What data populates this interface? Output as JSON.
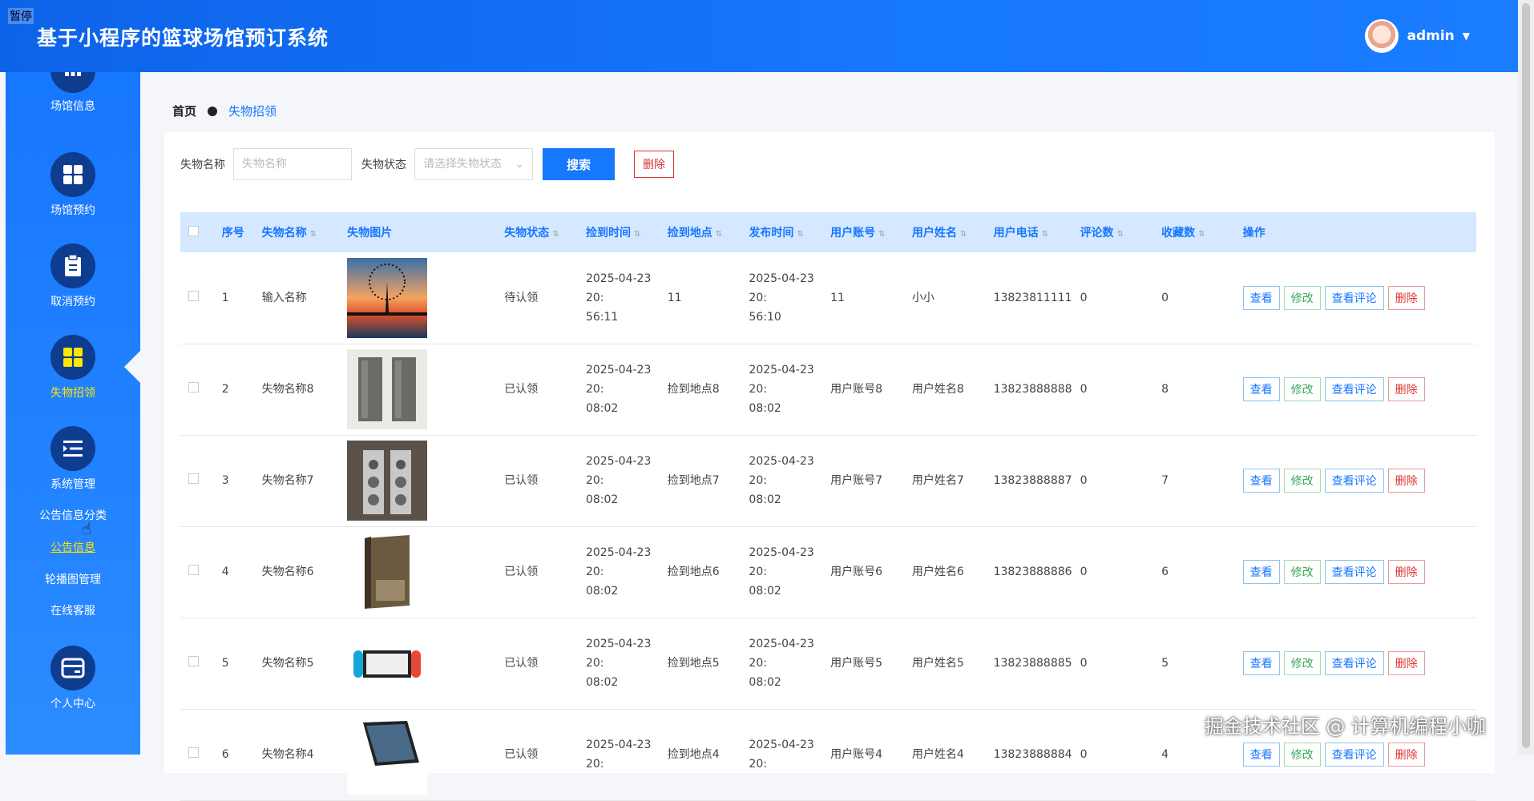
{
  "header": {
    "title": "基于小程序的篮球场馆预订系统",
    "paused": "暂停",
    "user": "admin"
  },
  "sidebar": {
    "items": [
      {
        "label": "场馆信息"
      },
      {
        "label": "场馆预约"
      },
      {
        "label": "取消预约"
      },
      {
        "label": "失物招领"
      },
      {
        "label": "系统管理"
      }
    ],
    "sub_items": [
      "公告信息分类",
      "公告信息",
      "轮播图管理",
      "在线客服"
    ],
    "personal": "个人中心"
  },
  "breadcrumb": {
    "home": "首页",
    "current": "失物招领"
  },
  "filters": {
    "name_label": "失物名称",
    "name_placeholder": "失物名称",
    "status_label": "失物状态",
    "status_placeholder": "请选择失物状态",
    "search": "搜索",
    "delete": "删除"
  },
  "table": {
    "headers": [
      "序号",
      "失物名称",
      "失物图片",
      "失物状态",
      "捡到时间",
      "捡到地点",
      "发布时间",
      "用户账号",
      "用户姓名",
      "用户电话",
      "评论数",
      "收藏数",
      "操作"
    ],
    "ops": {
      "view": "查看",
      "edit": "修改",
      "comments": "查看评论",
      "delete": "删除"
    },
    "rows": [
      {
        "no": "1",
        "name": "输入名称",
        "status": "待认领",
        "found_time": "2025-04-23 20:\n56:11",
        "place": "11",
        "pub_time": "2025-04-23 20:\n56:10",
        "account": "11",
        "uname": "小小",
        "phone": "13823811111",
        "comments": "0",
        "favs": "0"
      },
      {
        "no": "2",
        "name": "失物名称8",
        "status": "已认领",
        "found_time": "2025-04-23 20:\n08:02",
        "place": "捡到地点8",
        "pub_time": "2025-04-23 20:\n08:02",
        "account": "用户账号8",
        "uname": "用户姓名8",
        "phone": "13823888888",
        "comments": "0",
        "favs": "8"
      },
      {
        "no": "3",
        "name": "失物名称7",
        "status": "已认领",
        "found_time": "2025-04-23 20:\n08:02",
        "place": "捡到地点7",
        "pub_time": "2025-04-23 20:\n08:02",
        "account": "用户账号7",
        "uname": "用户姓名7",
        "phone": "13823888887",
        "comments": "0",
        "favs": "7"
      },
      {
        "no": "4",
        "name": "失物名称6",
        "status": "已认领",
        "found_time": "2025-04-23 20:\n08:02",
        "place": "捡到地点6",
        "pub_time": "2025-04-23 20:\n08:02",
        "account": "用户账号6",
        "uname": "用户姓名6",
        "phone": "13823888886",
        "comments": "0",
        "favs": "6"
      },
      {
        "no": "5",
        "name": "失物名称5",
        "status": "已认领",
        "found_time": "2025-04-23 20:\n08:02",
        "place": "捡到地点5",
        "pub_time": "2025-04-23 20:\n08:02",
        "account": "用户账号5",
        "uname": "用户姓名5",
        "phone": "13823888885",
        "comments": "0",
        "favs": "5"
      },
      {
        "no": "6",
        "name": "失物名称4",
        "status": "已认领",
        "found_time": "2025-04-23 20:",
        "place": "捡到地点4",
        "pub_time": "2025-04-23 20:",
        "account": "用户账号4",
        "uname": "用户姓名4",
        "phone": "13823888884",
        "comments": "0",
        "favs": "4"
      }
    ]
  },
  "watermark": "掘金技术社区 @ 计算机编程小咖"
}
